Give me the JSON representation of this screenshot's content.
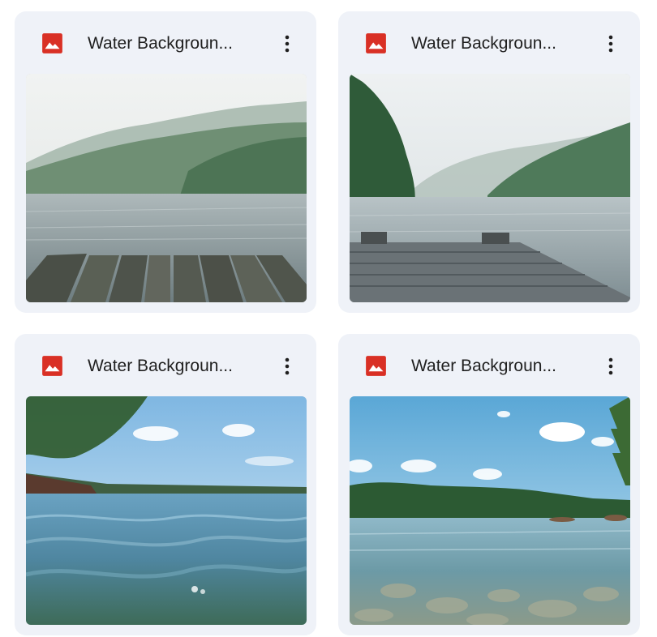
{
  "files": [
    {
      "name": "Water Background",
      "display_name": "Water Backgroun...",
      "type_icon": "image-file-icon",
      "menu_icon": "more-vert-icon"
    },
    {
      "name": "Water Background",
      "display_name": "Water Backgroun...",
      "type_icon": "image-file-icon",
      "menu_icon": "more-vert-icon"
    },
    {
      "name": "Water Background",
      "display_name": "Water Backgroun...",
      "type_icon": "image-file-icon",
      "menu_icon": "more-vert-icon"
    },
    {
      "name": "Water Background",
      "display_name": "Water Backgroun...",
      "type_icon": "image-file-icon",
      "menu_icon": "more-vert-icon"
    }
  ],
  "colors": {
    "card_bg": "#eff2f8",
    "image_icon_red": "#d93025",
    "title_text": "#1f1f1f"
  }
}
